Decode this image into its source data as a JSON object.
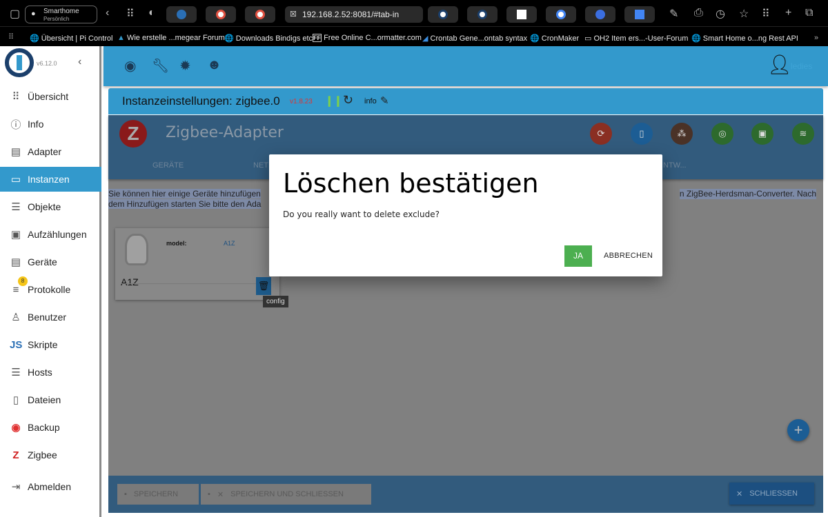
{
  "browser": {
    "profile": {
      "name": "Smarthome",
      "subtitle": "Persönlich"
    },
    "url": "192.168.2.52:8081/#tab-in",
    "bookmarks": [
      "Übersicht | Pi Control",
      "Wie erstelle ...megear Forum",
      "Downloads Bindigs etc",
      "Free Online C...ormatter.com",
      "Crontab Gene...ontab syntax",
      "CronMaker",
      "OH2 Item ers...-User-Forum",
      "Smart Home o...ng Rest API"
    ]
  },
  "sidebar": {
    "version": "v6.12.0",
    "items": [
      {
        "label": "Übersicht",
        "icon": "grid-icon"
      },
      {
        "label": "Info",
        "icon": "info-icon"
      },
      {
        "label": "Adapter",
        "icon": "store-icon"
      },
      {
        "label": "Instanzen",
        "icon": "instances-icon",
        "active": true
      },
      {
        "label": "Objekte",
        "icon": "list-icon"
      },
      {
        "label": "Aufzählungen",
        "icon": "enum-icon"
      },
      {
        "label": "Geräte",
        "icon": "devices-icon"
      },
      {
        "label": "Protokolle",
        "icon": "log-icon",
        "badge": "8"
      },
      {
        "label": "Benutzer",
        "icon": "user-icon"
      },
      {
        "label": "Skripte",
        "icon": "js-icon"
      },
      {
        "label": "Hosts",
        "icon": "hosts-icon"
      },
      {
        "label": "Dateien",
        "icon": "files-icon"
      },
      {
        "label": "Backup",
        "icon": "backup-icon"
      },
      {
        "label": "Zigbee",
        "icon": "zigbee-icon"
      },
      {
        "label": "Abmelden",
        "icon": "logout-icon"
      }
    ]
  },
  "appbar": {
    "user": "ledies"
  },
  "instance": {
    "title": "Instanzeinstellungen: zigbee.0",
    "version": "v1.8.23",
    "info": "info"
  },
  "adapter": {
    "title": "Zigbee-Adapter",
    "tabs": [
      "GERÄTE",
      "NET",
      "NTW..."
    ],
    "description_line1_left": "Sie können hier einige Geräte hinzufügen",
    "description_line1_right": "n ZigBee-Herdsman-Converter. Nach",
    "description_line2_left": "dem Hinzufügen starten Sie bitte den Ada",
    "card": {
      "model_label": "model:",
      "model_value": "A1Z",
      "name": "A1Z",
      "tooltip": "config"
    },
    "footer": {
      "save": "SPEICHERN",
      "save_close": "SPEICHERN UND SCHLIESSEN",
      "close": "SCHLIESSEN"
    }
  },
  "dialog": {
    "title": "Löschen bestätigen",
    "message": "Do you really want to delete exclude?",
    "confirm": "JA",
    "cancel": "ABBRECHEN"
  },
  "colors": {
    "accent": "#3399cc",
    "confirm": "#4caf50"
  }
}
